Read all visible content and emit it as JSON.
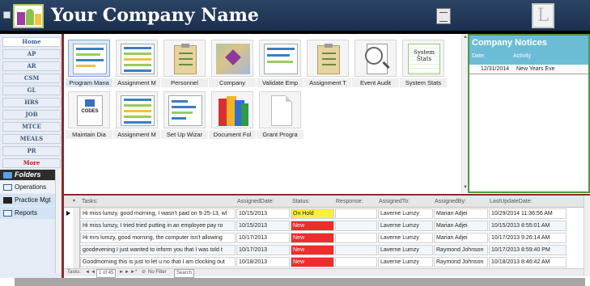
{
  "header": {
    "company_name": "Your Company Name"
  },
  "nav": {
    "items": [
      {
        "label": "Home"
      },
      {
        "label": "AP"
      },
      {
        "label": "AR"
      },
      {
        "label": "CSM"
      },
      {
        "label": "GL"
      },
      {
        "label": "HRS"
      },
      {
        "label": "JOB"
      },
      {
        "label": "MTCE"
      },
      {
        "label": "MEALS"
      },
      {
        "label": "PR"
      },
      {
        "label": "More"
      }
    ]
  },
  "folders": {
    "title": "Folders",
    "items": [
      {
        "label": "Operations"
      },
      {
        "label": "Practice Mgt"
      },
      {
        "label": "Reports"
      }
    ]
  },
  "tiles": [
    {
      "label": "Program Mana",
      "icon": "program-manager-icon"
    },
    {
      "label": "Assignment M",
      "icon": "assignment-spreadsheet-icon"
    },
    {
      "label": "Personnel",
      "icon": "clipboard-icon"
    },
    {
      "label": "Company",
      "icon": "map-icon"
    },
    {
      "label": "Validate Emp",
      "icon": "validate-sheet-icon"
    },
    {
      "label": "Assignment T",
      "icon": "clipboard-icon"
    },
    {
      "label": "Event Audit",
      "icon": "magnifier-icon"
    },
    {
      "label": "System Stats",
      "icon": "system-stats-icon",
      "art_text": "System Stats"
    },
    {
      "label": "Maintain Dia",
      "icon": "codes-icon",
      "art_text": "CODES"
    },
    {
      "label": "Assignment M",
      "icon": "assignment-spreadsheet-icon"
    },
    {
      "label": "Set Up Wizar",
      "icon": "wizard-doc-icon"
    },
    {
      "label": "Document Fol",
      "icon": "books-icon"
    },
    {
      "label": "Grant Progra",
      "icon": "blank-doc-icon"
    }
  ],
  "notices": {
    "title": "Company Notices",
    "col_date": "Date:",
    "col_activity": "Activity",
    "rows": [
      {
        "date": "12/31/2014",
        "activity": "New Years Eve"
      }
    ]
  },
  "tasks": {
    "headers": {
      "task": "Tasks:",
      "assigned_date": "AssignedDate:",
      "status": "Status:",
      "response": "Response:",
      "assigned_to": "AssignedTo:",
      "assigned_by": "AssignedBy:",
      "last_update": "LastUpdateDate:"
    },
    "rows": [
      {
        "task": "Hi miss lumzy, good morning, I wasn't paid on 9-25-13, wl",
        "assigned_date": "10/15/2013",
        "status": "On Hold",
        "response": "",
        "assigned_to": "Laverne Lumzy",
        "assigned_by": "Marian Adjei",
        "last_update": "10/29/2014 11:36:56 AM"
      },
      {
        "task": "Hi miss lumzy, I tried tried putting in an employee pay ro",
        "assigned_date": "10/15/2013",
        "status": "New",
        "response": "",
        "assigned_to": "Laverne Lumzy",
        "assigned_by": "Marian Adjei",
        "last_update": "10/15/2013 8:55:01 AM"
      },
      {
        "task": "Hi mrs lumzy, good morning, the computer isn't allowing",
        "assigned_date": "10/17/2013",
        "status": "New",
        "response": "",
        "assigned_to": "Laverne Lumzy",
        "assigned_by": "Marian Adjei",
        "last_update": "10/17/2013 9:26:14 AM"
      },
      {
        "task": "goodevening I just wanted to inform you that I was told t",
        "assigned_date": "10/17/2013",
        "status": "New",
        "response": "",
        "assigned_to": "Laverne Lumzy",
        "assigned_by": "Raymond Johnson",
        "last_update": "10/17/2013 8:59:40 PM"
      },
      {
        "task": "Goodmorning this is just to let u no that I am clocking out",
        "assigned_date": "10/18/2013",
        "status": "New",
        "response": "",
        "assigned_to": "Laverne Lumzy",
        "assigned_by": "Raymond Johnson",
        "last_update": "10/18/2013 8:46:42 AM"
      }
    ],
    "navbar": {
      "label": "Tasks:",
      "record": "1 of 45",
      "filter": "No Filter",
      "search": "Search"
    }
  }
}
